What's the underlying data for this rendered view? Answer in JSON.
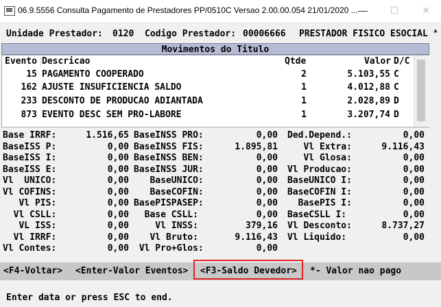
{
  "window": {
    "title": "06.9.5556  Consulta  Pagamento de Prestadores PP/0510C Versao 2.00.00.054 21/01/2020 ...",
    "min_glyph": "—",
    "max_glyph": "☐",
    "close_glyph": "✕"
  },
  "header_line": {
    "unidade_label": "Unidade Prestador:",
    "unidade_value": "0120",
    "codigo_label": "Codigo Prestador:",
    "codigo_value": "00006666",
    "tipo": "PRESTADOR FISICO ESOCIAL"
  },
  "movimentos": {
    "title": "Movimentos do Titulo",
    "columns": {
      "evento": "Evento",
      "descricao": "Descricao",
      "qtde": "Qtde",
      "valor": "Valor",
      "dc": "D/C"
    },
    "rows": [
      {
        "evento": "15",
        "descricao": "PAGAMENTO COOPERADO",
        "qtde": "2",
        "valor": "5.103,55",
        "dc": "C"
      },
      {
        "evento": "162",
        "descricao": "AJUSTE INSUFICIENCIA SALDO",
        "qtde": "1",
        "valor": "4.012,88",
        "dc": "C"
      },
      {
        "evento": "233",
        "descricao": "DESCONTO DE PRODUCAO ADIANTADA",
        "qtde": "1",
        "valor": "2.028,89",
        "dc": "D"
      },
      {
        "evento": "873",
        "descricao": "EVENTO DESC SEM PRO-LABORE",
        "qtde": "1",
        "valor": "3.207,74",
        "dc": "D"
      }
    ]
  },
  "totals": {
    "col1": [
      {
        "label": "Base IRRF:",
        "value": "1.516,65"
      },
      {
        "label": "BaseISS P:",
        "value": "0,00"
      },
      {
        "label": "BaseISS I:",
        "value": "0,00"
      },
      {
        "label": "BaseISS E:",
        "value": "0,00"
      },
      {
        "label": "Vl  UNICO:",
        "value": "0,00"
      },
      {
        "label": "Vl COFINS:",
        "value": "0,00"
      },
      {
        "label": "   Vl PIS:",
        "value": "0,00"
      },
      {
        "label": "  Vl CSLL:",
        "value": "0,00"
      },
      {
        "label": "   VL ISS:",
        "value": "0,00"
      },
      {
        "label": "  Vl IRRF:",
        "value": "0,00"
      },
      {
        "label": "Vl Contes:",
        "value": "0,00"
      }
    ],
    "col2": [
      {
        "label": "BaseINSS PRO:",
        "value": "0,00"
      },
      {
        "label": "BaseINSS FIS:",
        "value": "1.895,81"
      },
      {
        "label": "BaseINSS BEN:",
        "value": "0,00"
      },
      {
        "label": "BaseINSS JUR:",
        "value": "0,00"
      },
      {
        "label": "   BaseUNICO:",
        "value": "0,00"
      },
      {
        "label": "   BaseCOFIN:",
        "value": "0,00"
      },
      {
        "label": "BasePISPASEP:",
        "value": "0,00"
      },
      {
        "label": "  Base CSLL:",
        "value": "0,00"
      },
      {
        "label": "    Vl INSS:",
        "value": "379,16"
      },
      {
        "label": "   Vl Bruto:",
        "value": "9.116,43"
      },
      {
        "label": " Vl Pro+Glos:",
        "value": "0,00"
      }
    ],
    "col3": [
      {
        "label": "Ded.Depend.:",
        "value": "0,00"
      },
      {
        "label": "   Vl Extra:",
        "value": "9.116,43"
      },
      {
        "label": "   Vl Glosa:",
        "value": "0,00"
      },
      {
        "label": "Vl Producao:",
        "value": "0,00"
      },
      {
        "label": "BaseUNICO I:",
        "value": "0,00"
      },
      {
        "label": "BaseCOFIN I:",
        "value": "0,00"
      },
      {
        "label": "  BasePIS I:",
        "value": "0,00"
      },
      {
        "label": "BaseCSLL I:",
        "value": "0,00"
      },
      {
        "label": "Vl Desconto:",
        "value": "8.737,27"
      },
      {
        "label": "Vl Liquido:",
        "value": "0,00"
      }
    ]
  },
  "function_bar": {
    "f4": "<F4-Voltar>",
    "enter": "<Enter-Valor Eventos>",
    "f3": "<F3-Saldo Devedor>",
    "legend": "*- Valor nao pago"
  },
  "status": "Enter data or press ESC to end."
}
